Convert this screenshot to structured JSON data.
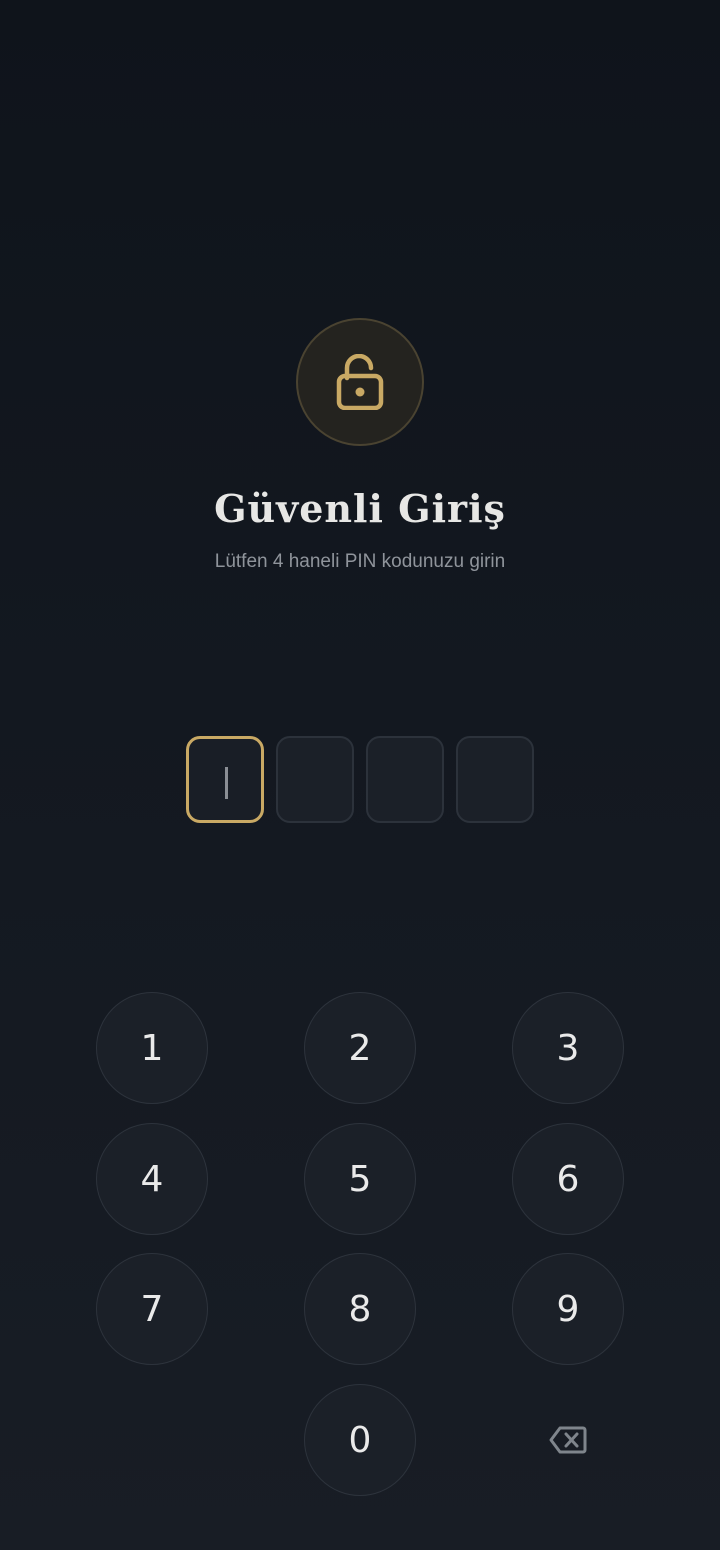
{
  "header": {
    "icon": "lock-open-icon",
    "title": "Güvenli Giriş",
    "subtitle": "Lütfen 4 haneli PIN kodunuzu girin"
  },
  "pin": {
    "length": 4,
    "filled": 0,
    "active_index": 0,
    "values": [
      "",
      "",
      "",
      ""
    ]
  },
  "keypad": {
    "keys": [
      "1",
      "2",
      "3",
      "4",
      "5",
      "6",
      "7",
      "8",
      "9",
      "0"
    ],
    "delete_icon": "backspace-icon"
  },
  "colors": {
    "accent": "#c9a964",
    "background": "#131820",
    "key_background": "#1b2028",
    "text_primary": "#e7e7e5",
    "text_secondary": "#8f949b"
  }
}
